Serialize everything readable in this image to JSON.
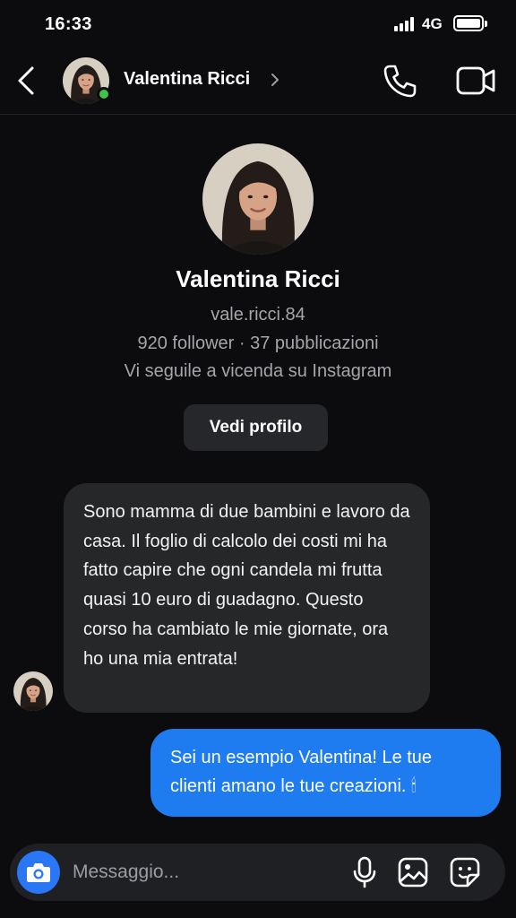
{
  "status_bar": {
    "time": "16:33",
    "network": "4G"
  },
  "header": {
    "contact_name": "Valentina Ricci",
    "online": true,
    "icons": [
      "back-arrow-icon",
      "chevron-right-icon",
      "phone-icon",
      "video-camera-icon"
    ]
  },
  "profile": {
    "name": "Valentina Ricci",
    "handle": "vale.ricci.84",
    "stats": "920 follower · 37 pubblicazioni",
    "mutual": "Vi seguile a vicenda su Instagram",
    "view_profile_label": "Vedi profilo"
  },
  "messages": [
    {
      "direction": "incoming",
      "text": "Sono mamma di due bambini e lavoro da casa. Il foglio di calcolo dei costi mi ha fatto capire che ogni candela mi frutta quasi 10 euro di guadagno. Questo corso ha cambiato le mie giornate, ora ho una mia entrata!"
    },
    {
      "direction": "outgoing",
      "text": "Sei un esempio Valentina! Le tue clienti amano le tue creazioni. 🕯"
    }
  ],
  "composer": {
    "placeholder": "Messaggio...",
    "icons": [
      "camera-icon",
      "microphone-icon",
      "gallery-icon",
      "sticker-icon"
    ]
  },
  "colors": {
    "background": "#0c0c0e",
    "incoming_bubble": "#262729",
    "outgoing_bubble": "#1e7cf0",
    "camera_button": "#2a77f5",
    "online_dot": "#3ec34a",
    "secondary_text": "#a5a5ab"
  }
}
